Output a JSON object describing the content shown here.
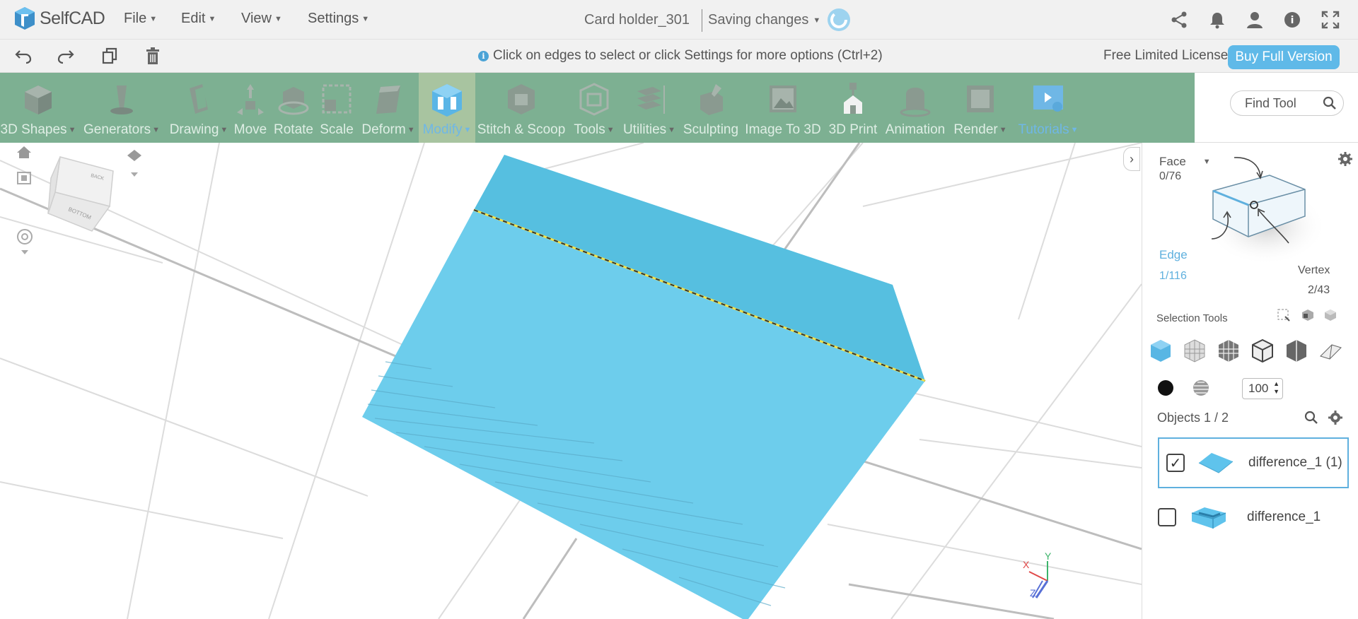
{
  "app": {
    "logo_text": "SelfCAD",
    "menus": [
      {
        "label": "File"
      },
      {
        "label": "Edit"
      },
      {
        "label": "View"
      },
      {
        "label": "Settings"
      }
    ],
    "project_title": "Card holder_301",
    "save_status": "Saving changes"
  },
  "topbar_icons": [
    "share-icon",
    "bell-icon",
    "user-icon",
    "help-icon",
    "fullscreen-icon"
  ],
  "subbar": {
    "hint": "Click on edges to select or click Settings for more options (Ctrl+2)",
    "license": "Free Limited License",
    "buy_label": "Buy Full Version"
  },
  "ribbon": {
    "tools": [
      {
        "label": "3D Shapes",
        "dropdown": true
      },
      {
        "label": "Generators",
        "dropdown": true
      },
      {
        "label": "Drawing",
        "dropdown": true
      },
      {
        "label": "Move",
        "dropdown": false
      },
      {
        "label": "Rotate",
        "dropdown": false
      },
      {
        "label": "Scale",
        "dropdown": false
      },
      {
        "label": "Deform",
        "dropdown": true
      },
      {
        "label": "Modify",
        "dropdown": true,
        "active": true
      },
      {
        "label": "Stitch & Scoop",
        "dropdown": false
      },
      {
        "label": "Tools",
        "dropdown": true
      },
      {
        "label": "Utilities",
        "dropdown": true
      },
      {
        "label": "Sculpting",
        "dropdown": false
      },
      {
        "label": "Image To 3D",
        "dropdown": false
      },
      {
        "label": "3D Print",
        "dropdown": false
      },
      {
        "label": "Animation",
        "dropdown": false
      },
      {
        "label": "Render",
        "dropdown": true
      },
      {
        "label": "Tutorials",
        "dropdown": true
      }
    ],
    "find_tool_placeholder": "Find Tool"
  },
  "viewcube": {
    "face_top": "BACK",
    "face_front": "BOTTOM"
  },
  "axes": {
    "x": "X",
    "y": "Y",
    "z": "Z"
  },
  "selection": {
    "face_label": "Face",
    "face_count": "0/76",
    "edge_label": "Edge",
    "edge_count": "1/116",
    "vertex_label": "Vertex",
    "vertex_count": "2/43",
    "tools_label": "Selection Tools",
    "opacity_value": "100"
  },
  "objects": {
    "header": "Objects 1 / 2",
    "items": [
      {
        "name": "difference_1 (1)",
        "checked": true,
        "check_mark": "✓"
      },
      {
        "name": "difference_1",
        "checked": false,
        "check_mark": ""
      }
    ]
  },
  "colors": {
    "ribbon": "#7db092",
    "accent": "#5fb9e8",
    "model": "#6dcdec",
    "model_top": "#56bfe0"
  }
}
